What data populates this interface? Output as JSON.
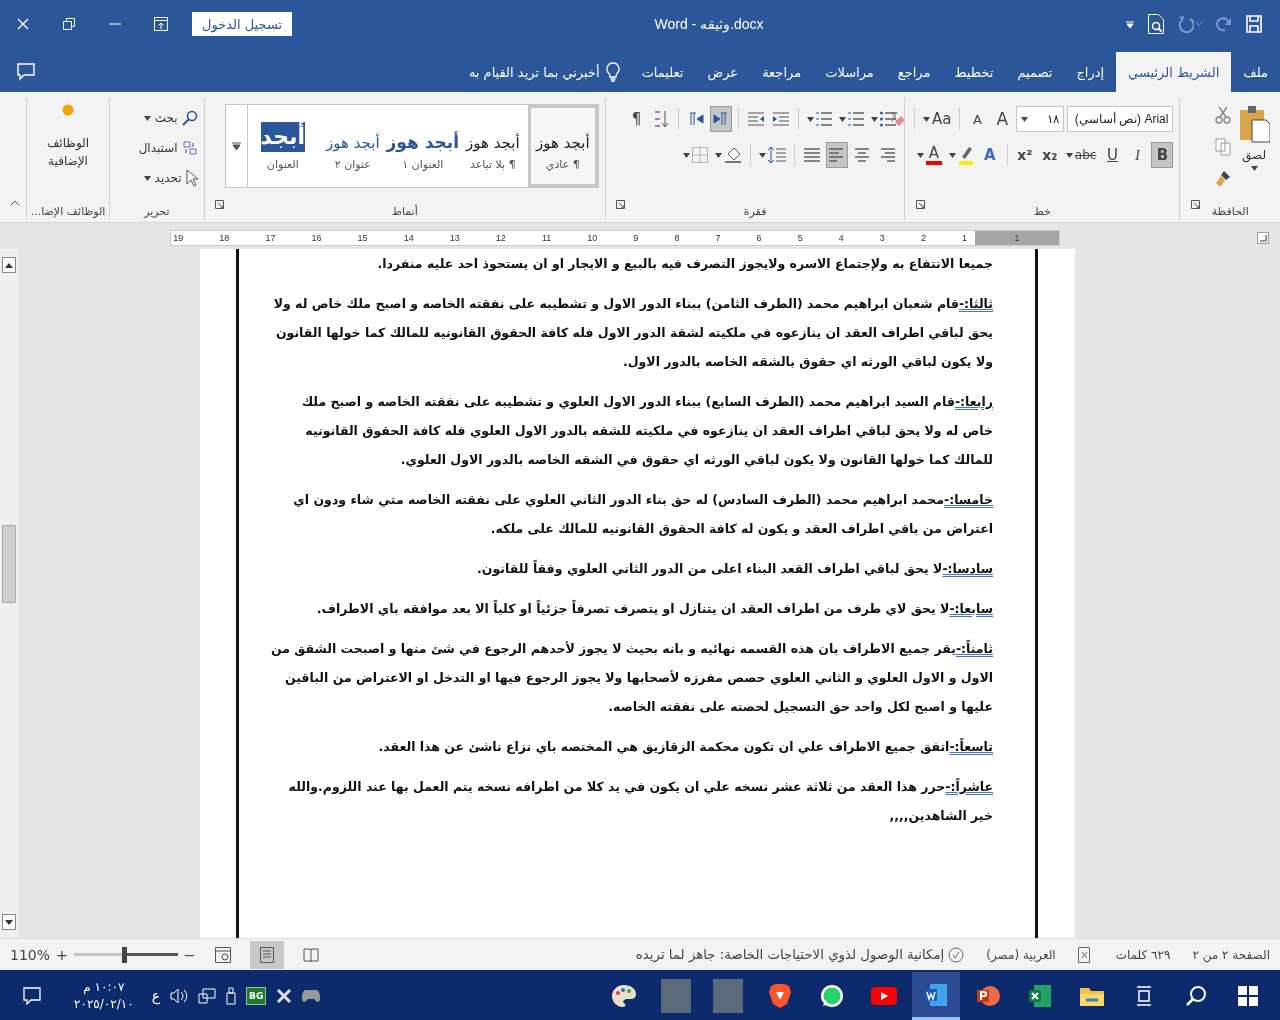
{
  "window": {
    "title": "Word  -  وثيقه.docx",
    "sign_in": "تسجيل الدخول"
  },
  "tabs": [
    {
      "label": "ملف",
      "selected": false
    },
    {
      "label": "الشريط الرئيسي",
      "selected": true
    },
    {
      "label": "إدراج",
      "selected": false
    },
    {
      "label": "تصميم",
      "selected": false
    },
    {
      "label": "تخطيط",
      "selected": false
    },
    {
      "label": "مراجع",
      "selected": false
    },
    {
      "label": "مراسلات",
      "selected": false
    },
    {
      "label": "مراجعة",
      "selected": false
    },
    {
      "label": "عرض",
      "selected": false
    },
    {
      "label": "تعليمات",
      "selected": false
    }
  ],
  "tell_me": {
    "placeholder": "أخبرني بما تريد القيام به"
  },
  "ribbon": {
    "clipboard": {
      "paste": "لصق",
      "label": "الحافظة"
    },
    "font": {
      "name": "Arial (نص أساسي)",
      "size": "١٨",
      "grow": "A",
      "shrink": "A",
      "change_case": "Aa",
      "text_effects": "A",
      "font_color": "A",
      "label": "خط",
      "format_buttons": [
        {
          "label": "B",
          "kind": "bold",
          "selected": true
        },
        {
          "label": "I",
          "kind": "italic",
          "selected": false
        },
        {
          "label": "U",
          "kind": "underline",
          "selected": false
        },
        {
          "label": "abc",
          "kind": "strike",
          "selected": false
        },
        {
          "label": "x₂",
          "kind": "subscript",
          "selected": false
        },
        {
          "label": "x²",
          "kind": "superscript",
          "selected": false
        }
      ]
    },
    "paragraph": {
      "show_marks": "¶",
      "label": "فقرة",
      "direction_buttons": [
        {
          "kind": "rtl",
          "selected": true
        },
        {
          "kind": "ltr",
          "selected": false
        }
      ],
      "alignment": [
        {
          "kind": "right",
          "selected": false
        },
        {
          "kind": "center",
          "selected": false
        },
        {
          "kind": "left",
          "selected": true
        },
        {
          "kind": "justify",
          "selected": false
        }
      ]
    },
    "styles": {
      "label": "أنماط",
      "items": [
        {
          "sample": "أبجد هوز",
          "name": "¶ عادي",
          "kind": "normal",
          "selected": true
        },
        {
          "sample": "أبجد هوز",
          "name": "¶ بلا تباعد",
          "kind": "normal",
          "selected": false
        },
        {
          "sample": "أبجد هوز",
          "name": "العنوان ١",
          "kind": "heading1",
          "selected": false
        },
        {
          "sample": "أبجد هوز",
          "name": "عنوان ٢",
          "kind": "heading2",
          "selected": false
        },
        {
          "sample": "أبجد",
          "name": "العنوان",
          "kind": "title",
          "selected": false
        }
      ]
    },
    "editing": {
      "find": "بحث",
      "replace": "استبدال",
      "select": "تحديد",
      "label": "تحرير"
    },
    "addins": {
      "button": "الوظائف الإضافية",
      "label": "الوظائف الإضا..."
    }
  },
  "ruler": {
    "right_numbers": [
      "1"
    ],
    "numbers": [
      "1",
      "2",
      "3",
      "4",
      "5",
      "6",
      "7",
      "8",
      "9",
      "10",
      "11",
      "12",
      "13",
      "14",
      "15",
      "16",
      "17",
      "18",
      "19"
    ]
  },
  "document": {
    "paragraphs": [
      {
        "text": "جميعا الانتفاع به ولإجتماع الاسره ولايجوز التصرف فيه بالبيع و الايجار او ان يستحوذ احد عليه منفردا."
      },
      {
        "label": "ثالثا:-",
        "text": "قام شعبان ابراهيم محمد (الطرف الثامن) ببناء الدور الاول و تشطيبه على نفقته الخاصه و اصبح ملك خاص له ولا يحق لباقي اطراف العقد ان ينازعوه في ملكيته لشقة الدور الاول فله كافة الحقوق القانونيه للمالك كما خولها القانون ولا يكون لباقي الورثه اي حقوق بالشقه الخاصه بالدور الاول."
      },
      {
        "label": "رابعا:-",
        "text": "قام السيد ابراهيم محمد (الطرف السابع) ببناء الدور الاول العلوي و تشطيبه على نفقته الخاصه و اصبح ملك خاص له ولا يحق لباقي اطراف العقد ان ينازعوه في ملكيته للشقه بالدور الاول العلوي فله كافة الحقوق القانونيه للمالك كما خولها القانون ولا يكون لباقي الورثه اي حقوق في الشقه الخاصه بالدور الاول العلوي."
      },
      {
        "label": "خامسا:-",
        "text": "محمد ابراهيم محمد (الطرف السادس) له حق بناء الدور الثاني العلوي على نفقته الخاصه متي شاء ودون اي اعتراض من باقي اطراف العقد و يكون له كافة الحقوق القانونيه للمالك على ملكه."
      },
      {
        "label": "سادسا:-",
        "text": "لا يحق لباقي اطراف القعد البناء اعلى من الدور الثاني العلوي وفقاً للقانون."
      },
      {
        "label": "سابعا:-",
        "text": "لا يحق لاي طرف من اطراف العقد ان يتنازل او يتصرف تصرفاً جزئياً او كلياً الا بعد موافقه باي الاطراف."
      },
      {
        "label": "ثامناً:-",
        "text": "يقر جميع الاطراف بان هذه القسمه نهائيه و بانه بحيث لا يجوز لأحدهم الرجوع في شئ منها و اصبحت الشقق من الاول و الاول العلوي و الثاني العلوي حصص مفرزه لأصحابها ولا يجوز الرجوع فيها او التدخل او الاعتراض من الباقين عليها و اصبح لكل واحد حق التسجيل لحصته على نفقته الخاصه."
      },
      {
        "label": "تاسعاً:-",
        "text": "اتفق جميع الاطراف علي ان تكون محكمة الزقازيق هي المختصه باي نزاع ناشئ عن هذا العقد."
      },
      {
        "label": "عاشراً:-",
        "text": "حرر هذا العقد من ثلاثة عشر نسخه علي ان يكون في يد كلا من اطرافه نسخه يتم العمل بها عند اللزوم.والله خير الشاهدين,,,,"
      }
    ]
  },
  "status_bar": {
    "page": "الصفحة ٢ من ٢",
    "words": "٦٢٩ كلمات",
    "language": "العربية (مصر)",
    "accessibility": "إمكانية الوصول لذوي الاحتياجات الخاصة: جاهز لما تريده",
    "views": [
      {
        "kind": "read",
        "selected": false
      },
      {
        "kind": "print",
        "selected": true
      },
      {
        "kind": "web",
        "selected": false
      }
    ],
    "zoom": {
      "minus": "−",
      "plus": "+",
      "level": 0.52,
      "reading": "110%"
    }
  },
  "taskbar": {
    "apps": [
      {
        "kind": "start",
        "selected": false
      },
      {
        "kind": "search",
        "selected": false
      },
      {
        "kind": "taskview",
        "selected": false
      },
      {
        "kind": "folder",
        "selected": false
      },
      {
        "kind": "sheet",
        "selected": false
      },
      {
        "kind": "slides",
        "selected": false
      },
      {
        "kind": "doc",
        "selected": true
      },
      {
        "kind": "video",
        "selected": false
      },
      {
        "kind": "chat",
        "selected": false
      },
      {
        "kind": "browser",
        "selected": false
      },
      {
        "kind": "photo",
        "selected": false
      },
      {
        "kind": "photo",
        "selected": false
      },
      {
        "kind": "paint",
        "selected": false
      }
    ],
    "tray_badge": "BG",
    "language": "ع",
    "time": "١٠:٠٧ م",
    "date": "٢٠٢٥/٠٢/١٠"
  }
}
